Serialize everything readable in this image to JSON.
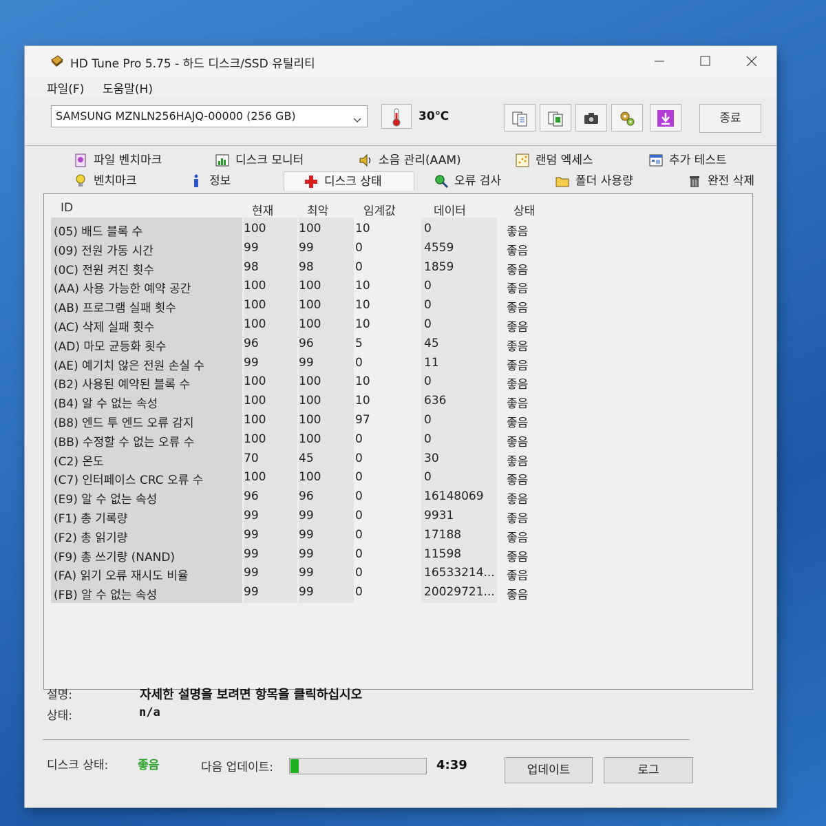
{
  "window": {
    "title": "HD Tune Pro 5.75 - 하드 디스크/SSD 유틸리티"
  },
  "menu": [
    "파일(F)",
    "도움말(H)"
  ],
  "toolbar": {
    "drive": "SAMSUNG MZNLN256HAJQ-00000 (256 GB)",
    "temperature": "30℃",
    "exit_label": "종료"
  },
  "tabs_row1": [
    "파일 벤치마크",
    "디스크 모니터",
    "소음 관리(AAM)",
    "랜덤 엑세스",
    "추가 테스트"
  ],
  "tabs_row2": [
    "벤치마크",
    "정보",
    "디스크 상태",
    "오류 검사",
    "폴더 사용량",
    "완전 삭제"
  ],
  "table": {
    "columns": [
      "ID",
      "현재",
      "최악",
      "임계값",
      "데이터",
      "상태"
    ],
    "rows": [
      [
        "(05) 배드 블록 수",
        "100",
        "100",
        "10",
        "0",
        "좋음"
      ],
      [
        "(09) 전원 가동 시간",
        "99",
        "99",
        "0",
        "4559",
        "좋음"
      ],
      [
        "(0C) 전원 켜진 횟수",
        "98",
        "98",
        "0",
        "1859",
        "좋음"
      ],
      [
        "(AA) 사용 가능한 예약 공간",
        "100",
        "100",
        "10",
        "0",
        "좋음"
      ],
      [
        "(AB) 프로그램 실패 횟수",
        "100",
        "100",
        "10",
        "0",
        "좋음"
      ],
      [
        "(AC) 삭제 실패 횟수",
        "100",
        "100",
        "10",
        "0",
        "좋음"
      ],
      [
        "(AD) 마모 균등화 횟수",
        "96",
        "96",
        "5",
        "45",
        "좋음"
      ],
      [
        "(AE) 예기치 않은 전원 손실 수",
        "99",
        "99",
        "0",
        "11",
        "좋음"
      ],
      [
        "(B2) 사용된 예약된 블록 수",
        "100",
        "100",
        "10",
        "0",
        "좋음"
      ],
      [
        "(B4) 알 수 없는 속성",
        "100",
        "100",
        "10",
        "636",
        "좋음"
      ],
      [
        "(B8) 엔드 투 엔드 오류 감지",
        "100",
        "100",
        "97",
        "0",
        "좋음"
      ],
      [
        "(BB) 수정할 수 없는 오류 수",
        "100",
        "100",
        "0",
        "0",
        "좋음"
      ],
      [
        "(C2) 온도",
        "70",
        "45",
        "0",
        "30",
        "좋음"
      ],
      [
        "(C7) 인터페이스 CRC 오류 수",
        "100",
        "100",
        "0",
        "0",
        "좋음"
      ],
      [
        "(E9) 알 수 없는 속성",
        "96",
        "96",
        "0",
        "16148069",
        "좋음"
      ],
      [
        "(F1) 총 기록량",
        "99",
        "99",
        "0",
        "9931",
        "좋음"
      ],
      [
        "(F2) 총 읽기량",
        "99",
        "99",
        "0",
        "17188",
        "좋음"
      ],
      [
        "(F9) 총 쓰기량 (NAND)",
        "99",
        "99",
        "0",
        "11598",
        "좋음"
      ],
      [
        "(FA) 읽기 오류 재시도 비율",
        "99",
        "99",
        "0",
        "16533214...",
        "좋음"
      ],
      [
        "(FB) 알 수 없는 속성",
        "99",
        "99",
        "0",
        "20029721...",
        "좋음"
      ]
    ]
  },
  "bottom": {
    "desc_label": "설명:",
    "desc_value": "자세한 설명을 보려면 항목을 클릭하십시오",
    "state_label": "상태:",
    "state_value": "n/a",
    "disk_label": "디스크 상태:",
    "disk_value": "좋음",
    "next_label": "다음 업데이트:",
    "progress_fraction": 0.06,
    "time_value": "4:39",
    "update_label": "업데이트",
    "log_label": "로그"
  },
  "colors": {
    "good": "#2ea62e",
    "progress": "#1fb01f"
  }
}
